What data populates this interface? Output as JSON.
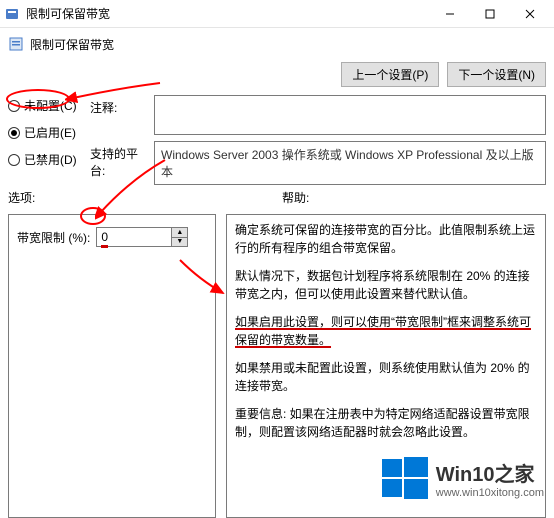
{
  "window": {
    "title": "限制可保留带宽",
    "toolbar_title": "限制可保留带宽"
  },
  "nav": {
    "prev": "上一个设置(P)",
    "next": "下一个设置(N)"
  },
  "radios": {
    "unconfigured": "未配置(C)",
    "enabled": "已启用(E)",
    "disabled": "已禁用(D)"
  },
  "fields": {
    "comment_label": "注释:",
    "comment_value": "",
    "platform_label": "支持的平台:",
    "platform_value": "Windows Server 2003 操作系统或 Windows XP Professional 及以上版本"
  },
  "panels": {
    "options_header": "选项:",
    "help_header": "帮助:"
  },
  "spinner": {
    "label": "带宽限制 (%):",
    "value": "0"
  },
  "help": {
    "p1": "确定系统可保留的连接带宽的百分比。此值限制系统上运行的所有程序的组合带宽保留。",
    "p2": "默认情况下，数据包计划程序将系统限制在 20% 的连接带宽之内，但可以使用此设置来替代默认值。",
    "p3": "如果启用此设置，则可以使用“带宽限制”框来调整系统可保留的带宽数量。",
    "p4": "如果禁用或未配置此设置，则系统使用默认值为 20% 的连接带宽。",
    "p5": "重要信息: 如果在注册表中为特定网络适配器设置带宽限制，则配置该网络适配器时就会忽略此设置。"
  },
  "watermark": {
    "brand": "Win10之家",
    "url": "www.win10xitong.com"
  },
  "icons": {
    "app": "app-icon",
    "minimize": "minimize-icon",
    "maximize": "maximize-icon",
    "close": "close-icon",
    "policy": "policy-icon"
  }
}
